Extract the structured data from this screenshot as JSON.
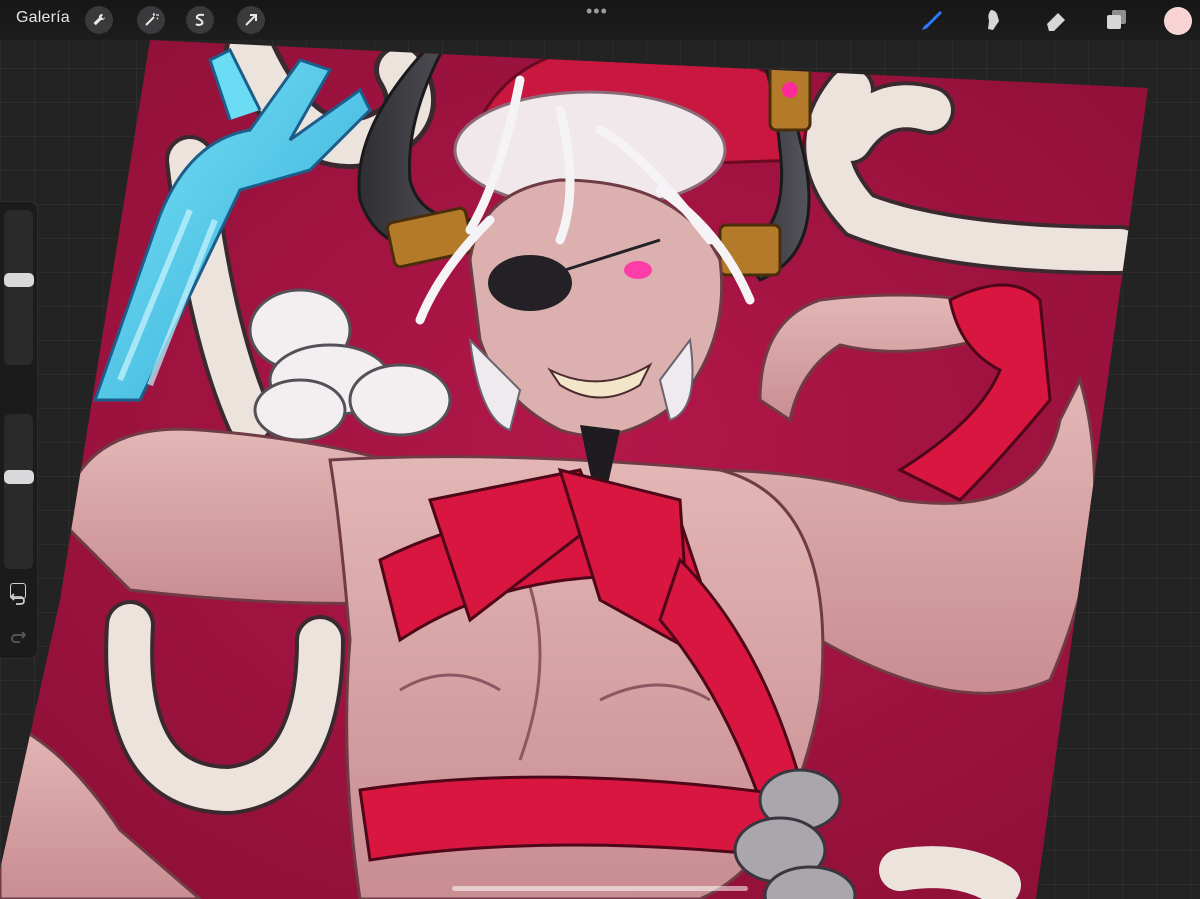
{
  "toolbar": {
    "gallery_label": "Galería",
    "left_tools": [
      "wrench-icon",
      "magic-wand-icon",
      "selection-icon",
      "transform-arrow-icon"
    ],
    "more_label": "•••",
    "right_tools": [
      "brush-icon",
      "smudge-icon",
      "eraser-icon",
      "layers-icon"
    ],
    "active_tool": "brush-icon",
    "active_tool_color": "#2f7bff",
    "current_color": "#f7d3d3"
  },
  "sidebar": {
    "brush_size_level": 0.55,
    "opacity_level": 0.6,
    "controls": [
      "brush-size-slider",
      "modify-button",
      "opacity-slider",
      "undo-button",
      "redo-button"
    ]
  },
  "artwork": {
    "background_color": "#a3173f",
    "ribbon_color": "#d8163f",
    "skin_color": "#d9a6a8",
    "hair_color": "#f2eef0",
    "letter_color": "#ebe3dc",
    "ghost_arm_color": "#4fd2ee"
  }
}
